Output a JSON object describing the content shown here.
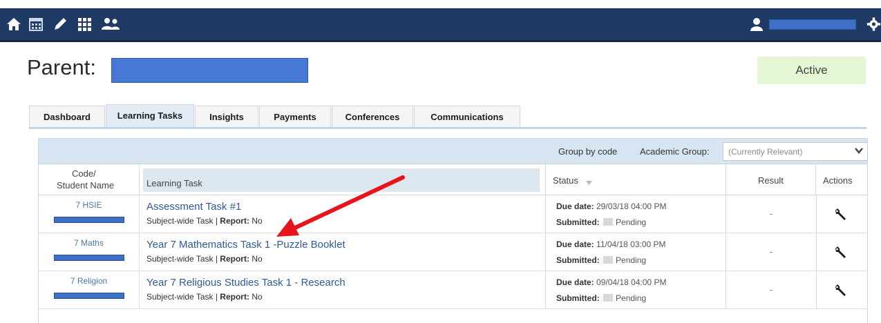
{
  "nav": {
    "icons": [
      "home-icon",
      "calendar-icon",
      "pencil-icon",
      "grid-icon",
      "people-icon",
      "user-icon",
      "gear-icon"
    ]
  },
  "header": {
    "parent_label": "Parent:",
    "status": "Active"
  },
  "tabs": [
    "Dashboard",
    "Learning Tasks",
    "Insights",
    "Payments",
    "Conferences",
    "Communications"
  ],
  "active_tab": "Learning Tasks",
  "toolbar": {
    "group_by_code": "Group by code",
    "academic_group_label": "Academic Group:",
    "academic_group_value": "(Currently Relevant)"
  },
  "table": {
    "columns": {
      "code_line1": "Code/",
      "code_line2": "Student Name",
      "learning_task": "Learning Task",
      "status": "Status",
      "result": "Result",
      "actions": "Actions"
    },
    "rows": [
      {
        "code": "7 HSIE",
        "title": "Assessment Task #1",
        "subject_label": "Subject-wide Task",
        "report_label": "Report:",
        "report_value": "No",
        "due_label": "Due date:",
        "due_value": "29/03/18 04:00 PM",
        "submitted_label": "Submitted:",
        "submitted_value": "Pending",
        "result": "-"
      },
      {
        "code": "7 Maths",
        "title": "Year 7 Mathematics Task 1 -Puzzle Booklet",
        "subject_label": "Subject-wide Task",
        "report_label": "Report:",
        "report_value": "No",
        "due_label": "Due date:",
        "due_value": "11/04/18 03:00 PM",
        "submitted_label": "Submitted:",
        "submitted_value": "Pending",
        "result": "-"
      },
      {
        "code": "7 Religion",
        "title": "Year 7 Religious Studies Task 1 - Research",
        "subject_label": "Subject-wide Task",
        "report_label": "Report:",
        "report_value": "No",
        "due_label": "Due date:",
        "due_value": "09/04/18 04:00 PM",
        "submitted_label": "Submitted:",
        "submitted_value": "Pending",
        "result": "-"
      }
    ]
  },
  "colors": {
    "nav_bar": "#1f3a64",
    "redaction": "#4878d6",
    "active_badge": "#e4f6d4",
    "link": "#2e5a9a",
    "annotation_arrow": "#e8141b"
  }
}
